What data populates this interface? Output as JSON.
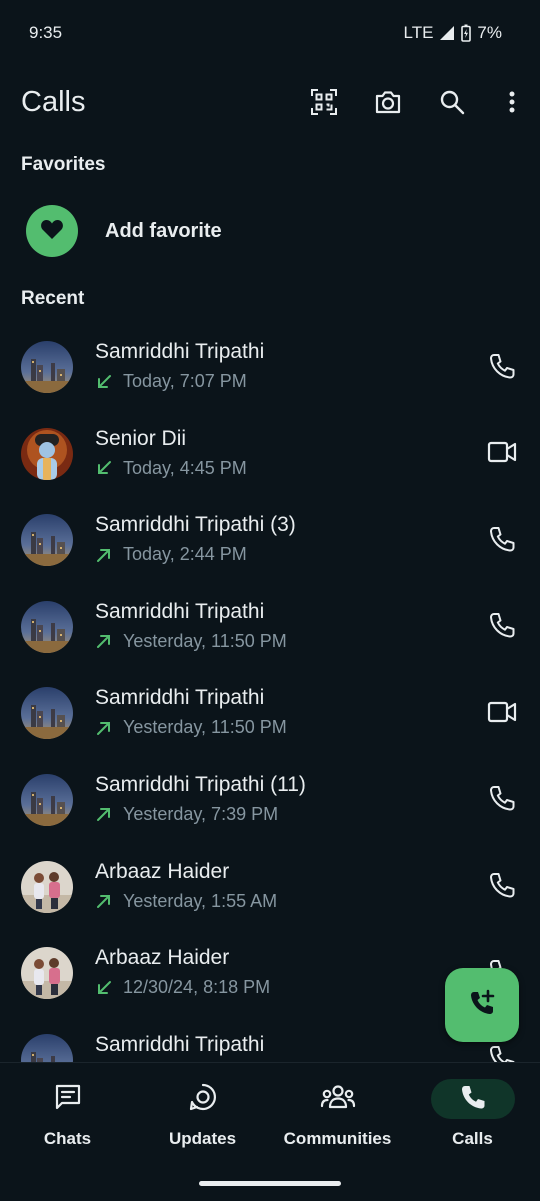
{
  "status_bar": {
    "time": "9:35",
    "network": "LTE",
    "battery": "7%"
  },
  "app_bar": {
    "title": "Calls",
    "actions": [
      "qr-code-icon",
      "camera-icon",
      "search-icon",
      "more-vert-icon"
    ]
  },
  "favorites": {
    "title": "Favorites",
    "add_label": "Add favorite"
  },
  "recent": {
    "title": "Recent",
    "calls": [
      {
        "name": "Samriddhi Tripathi",
        "direction": "incoming",
        "time": "Today, 7:07 PM",
        "type": "voice",
        "avatar": "city"
      },
      {
        "name": "Senior Dii",
        "direction": "incoming",
        "time": "Today, 4:45 PM",
        "type": "video",
        "avatar": "deity"
      },
      {
        "name": "Samriddhi Tripathi (3)",
        "direction": "outgoing",
        "time": "Today, 2:44 PM",
        "type": "voice",
        "avatar": "city"
      },
      {
        "name": "Samriddhi Tripathi",
        "direction": "outgoing",
        "time": "Yesterday, 11:50 PM",
        "type": "voice",
        "avatar": "city"
      },
      {
        "name": "Samriddhi Tripathi",
        "direction": "outgoing",
        "time": "Yesterday, 11:50 PM",
        "type": "video",
        "avatar": "city"
      },
      {
        "name": "Samriddhi Tripathi (11)",
        "direction": "outgoing",
        "time": "Yesterday, 7:39 PM",
        "type": "voice",
        "avatar": "city"
      },
      {
        "name": "Arbaaz Haider",
        "direction": "outgoing",
        "time": "Yesterday, 1:55 AM",
        "type": "voice",
        "avatar": "people"
      },
      {
        "name": "Arbaaz Haider",
        "direction": "incoming",
        "time": "12/30/24, 8:18 PM",
        "type": "voice",
        "avatar": "people"
      },
      {
        "name": "Samriddhi Tripathi",
        "direction": "outgoing",
        "time": "",
        "type": "voice",
        "avatar": "city"
      }
    ]
  },
  "bottom_nav": [
    {
      "label": "Chats",
      "icon": "chats-icon",
      "active": false
    },
    {
      "label": "Updates",
      "icon": "updates-icon",
      "active": false
    },
    {
      "label": "Communities",
      "icon": "communities-icon",
      "active": false
    },
    {
      "label": "Calls",
      "icon": "calls-icon",
      "active": true
    }
  ],
  "colors": {
    "background": "#0b141a",
    "accent": "#53bd6f",
    "text": "#e9edef",
    "muted": "#8696a0",
    "active_pill": "#103529"
  }
}
